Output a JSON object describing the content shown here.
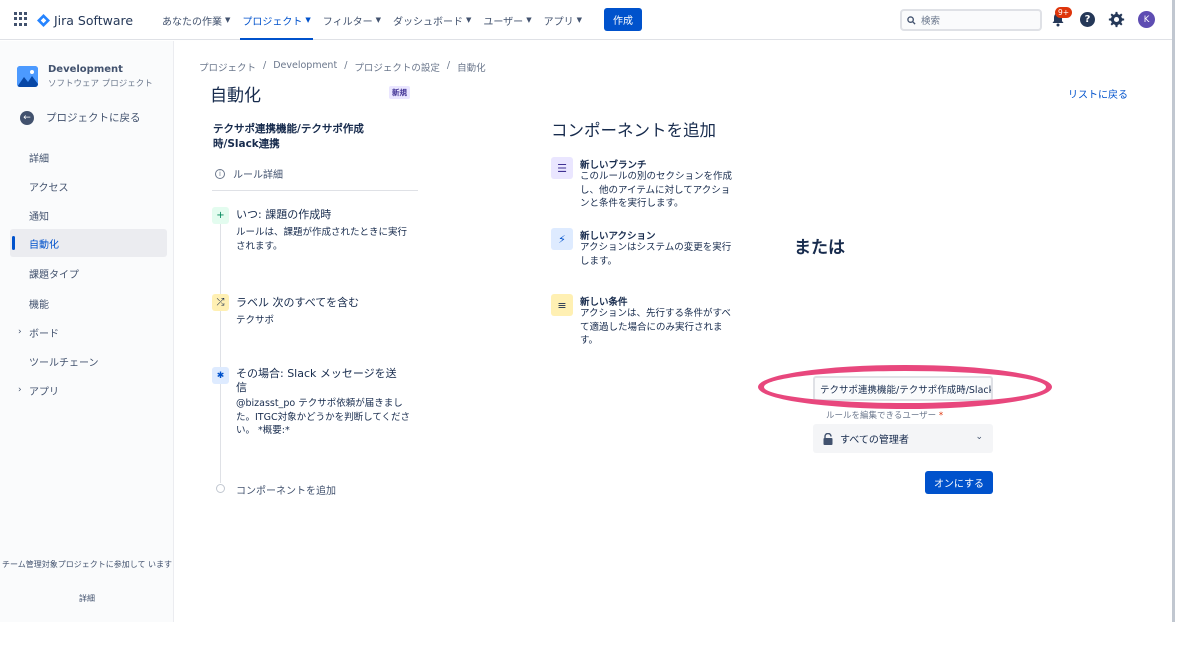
{
  "app": {
    "name": "Jira Software"
  },
  "nav": [
    {
      "label": "あなたの作業",
      "active": false
    },
    {
      "label": "プロジェクト",
      "active": true
    },
    {
      "label": "フィルター",
      "active": false
    },
    {
      "label": "ダッシュボード",
      "active": false
    },
    {
      "label": "ユーザー",
      "active": false
    },
    {
      "label": "アプリ",
      "active": false
    }
  ],
  "create_label": "作成",
  "search": {
    "placeholder": "検索"
  },
  "notifications": {
    "badge": "9+"
  },
  "user": {
    "initial": "K"
  },
  "sidebar": {
    "project_name": "Development",
    "project_type": "ソフトウェア プロジェクト",
    "back_label": "プロジェクトに戻る",
    "items": [
      {
        "label": "詳細"
      },
      {
        "label": "アクセス"
      },
      {
        "label": "通知"
      },
      {
        "label": "自動化",
        "active": true
      },
      {
        "label": "課題タイプ"
      },
      {
        "label": "機能"
      },
      {
        "label": "ボード",
        "expandable": true
      },
      {
        "label": "ツールチェーン"
      },
      {
        "label": "アプリ",
        "expandable": true
      }
    ],
    "footer_text": "チーム管理対象プロジェクトに参加して います",
    "footer_link": "詳細"
  },
  "breadcrumb": [
    "プロジェクト",
    "Development",
    "プロジェクトの設定",
    "自動化"
  ],
  "page": {
    "title": "自動化",
    "badge": "新規",
    "back_to_list": "リストに戻る"
  },
  "rule": {
    "name": "テクサポ連携機能/テクサポ作成時/Slack連携",
    "details_label": "ルール詳細",
    "steps": [
      {
        "icon": "plus-icon",
        "title": "いつ: 課題の作成時",
        "desc": "ルールは、課題が作成されたときに実行されます。"
      },
      {
        "icon": "shuffle-icon",
        "title": "ラベル 次のすべてを含む",
        "desc": "テクサポ"
      },
      {
        "icon": "slack-icon",
        "title": "その場合: Slack メッセージを送信",
        "desc": "@bizasst_po テクサポ依頼が届きました。ITGC対象かどうかを判断してください。 *概要:*"
      }
    ],
    "add_component": "コンポーネントを追加"
  },
  "components": {
    "title": "コンポーネントを追加",
    "items": [
      {
        "icon": "branch-icon",
        "title": "新しいブランチ",
        "desc": "このルールの別のセクションを作成し、他のアイテムに対してアクションと条件を実行します。",
        "color": "#eae6ff"
      },
      {
        "icon": "lightning-icon",
        "title": "新しいアクション",
        "desc": "アクションはシステムの変更を実行します。",
        "color": "#deebff"
      },
      {
        "icon": "filter-icon",
        "title": "新しい条件",
        "desc": "アクションは、先行する条件がすべて適過した場合にのみ実行されます。",
        "color": "#fff0b3"
      }
    ]
  },
  "publish": {
    "or_label": "または",
    "name_value": "テクサポ連携機能/テクサポ作成時/Slack連携",
    "editor_label": "ルールを編集できるユーザー",
    "editor_value": "すべての管理者",
    "enable_label": "オンにする"
  },
  "colors": {
    "brand": "#0052cc",
    "highlight": "#e8477d"
  }
}
